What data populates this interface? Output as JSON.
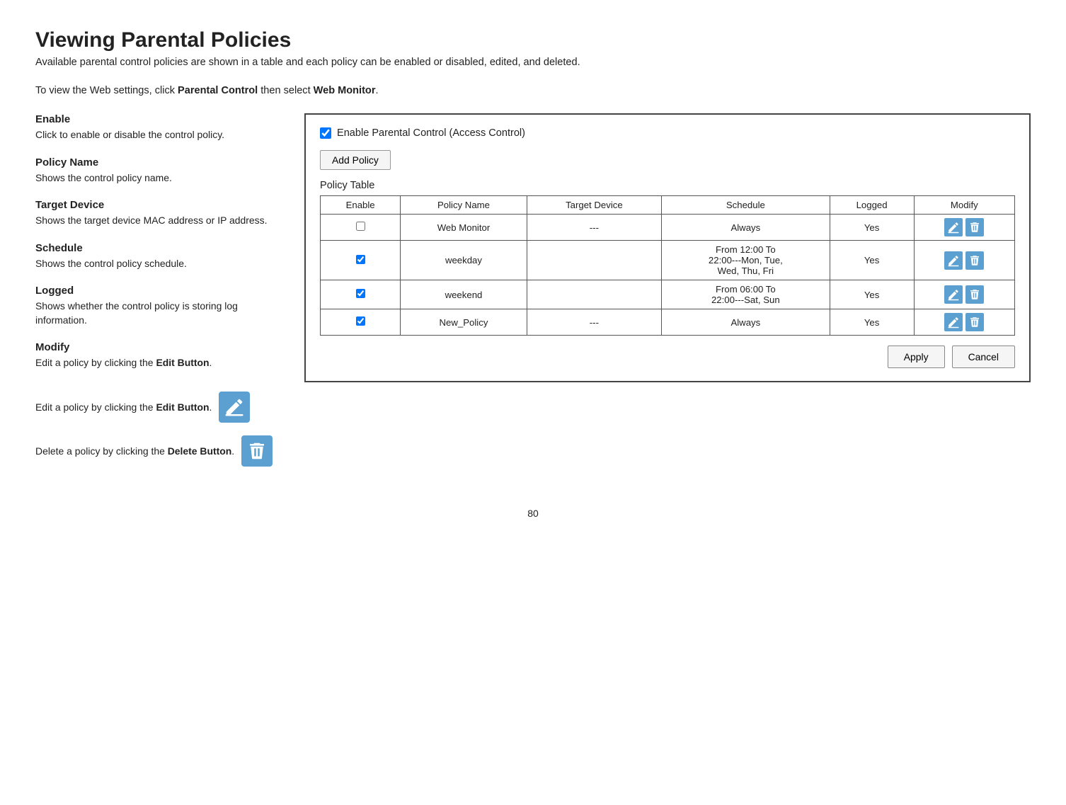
{
  "page": {
    "title": "Viewing Parental Policies",
    "subtitle": "Available parental control policies are shown in a table and each policy can be enabled or disabled, edited, and deleted.",
    "intro": "To view the Web settings, click Parental Control then select Web Monitor.",
    "intro_bold1": "Parental Control",
    "intro_bold2": "Web Monitor",
    "page_number": "80"
  },
  "left_sections": [
    {
      "title": "Enable",
      "desc": "Click to enable or disable the control policy."
    },
    {
      "title": "Policy Name",
      "desc": "Shows the control policy name."
    },
    {
      "title": "Target Device",
      "desc": "Shows the target device MAC address or IP address."
    },
    {
      "title": "Schedule",
      "desc": "Shows the control policy schedule."
    },
    {
      "title": "Logged",
      "desc": "Shows whether the control policy is storing log information."
    },
    {
      "title": "Modify",
      "desc": "Edit a policy by clicking the Edit Button."
    }
  ],
  "right_panel": {
    "enable_label": "Enable Parental Control (Access Control)",
    "add_policy_btn": "Add Policy",
    "table_title": "Policy Table",
    "columns": [
      "Enable",
      "Policy Name",
      "Target Device",
      "Schedule",
      "Logged",
      "Modify"
    ],
    "rows": [
      {
        "enable": true,
        "policy_name": "Web Monitor",
        "target_device": "---",
        "schedule": "Always",
        "logged": "Yes"
      },
      {
        "enable": true,
        "policy_name": "weekday",
        "target_device": "",
        "schedule": "From 12:00 To 22:00---Mon, Tue, Wed, Thu, Fri",
        "logged": "Yes"
      },
      {
        "enable": true,
        "policy_name": "weekend",
        "target_device": "",
        "schedule": "From 06:00 To 22:00---Sat, Sun",
        "logged": "Yes"
      },
      {
        "enable": true,
        "policy_name": "New_Policy",
        "target_device": "---",
        "schedule": "Always",
        "logged": "Yes"
      }
    ],
    "apply_btn": "Apply",
    "cancel_btn": "Cancel"
  },
  "bottom": {
    "edit_label": "Edit a policy by clicking the Edit Button.",
    "delete_label": "Delete a policy by clicking the Delete Button."
  }
}
